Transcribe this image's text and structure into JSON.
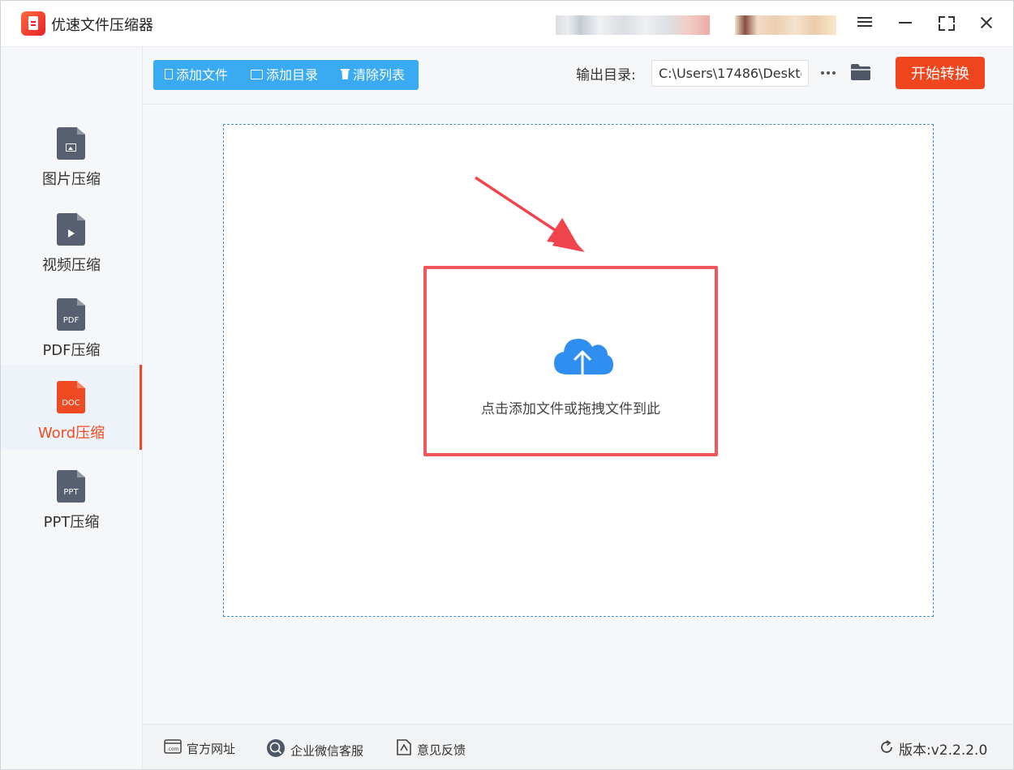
{
  "app": {
    "title": "优速文件压缩器"
  },
  "sidebar": {
    "items": [
      {
        "label": "图片压缩",
        "active": false
      },
      {
        "label": "视频压缩",
        "active": false
      },
      {
        "label": "PDF压缩",
        "icon_text": "PDF",
        "active": false
      },
      {
        "label": "Word压缩",
        "icon_text": "DOC",
        "active": true
      },
      {
        "label": "PPT压缩",
        "icon_text": "PPT",
        "active": false
      }
    ]
  },
  "toolbar": {
    "add_file": "添加文件",
    "add_folder": "添加目录",
    "clear_list": "清除列表",
    "output_label": "输出目录:",
    "output_path": "C:\\Users\\17486\\Deskto",
    "start": "开始转换"
  },
  "dropzone": {
    "hint": "点击添加文件或拖拽文件到此"
  },
  "footer": {
    "website": "官方网址",
    "website_icon_text": ".com",
    "wechat": "企业微信客服",
    "feedback": "意见反馈",
    "version_label": "版本:",
    "version_value": "v2.2.2.0"
  },
  "colors": {
    "accent": "#f0461f",
    "toolbar_blue": "#3aaaf3",
    "highlight_red": "#f0565c",
    "cloud_blue": "#2f8ff0"
  }
}
